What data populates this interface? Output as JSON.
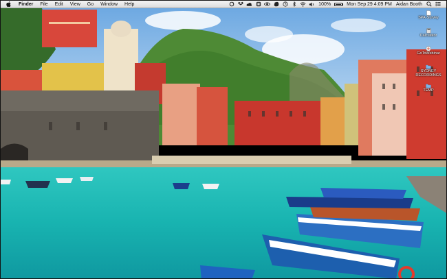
{
  "menubar": {
    "app_name": "Finder",
    "menus": [
      "File",
      "Edit",
      "View",
      "Go",
      "Window",
      "Help"
    ],
    "battery_percent": "100%",
    "datetime": "Mon Sep 29  4:09 PM",
    "user": "Aidan Booth"
  },
  "desktop_icons": [
    {
      "label": "SPA-Survey",
      "icon": "document-icon"
    },
    {
      "label": "Calculator",
      "icon": "calculator-icon"
    },
    {
      "label": "GoToWebinar",
      "icon": "gotowebinar-icon"
    },
    {
      "label": "SYDNEY\nRECORDINGS",
      "icon": "folder-icon"
    },
    {
      "label": "TEMP",
      "icon": "folder-icon"
    }
  ],
  "wallpaper": {
    "subject": "coastal-village-harbor",
    "sea_color": "#1fb8b0",
    "sky_color": "#7fb6e6"
  }
}
